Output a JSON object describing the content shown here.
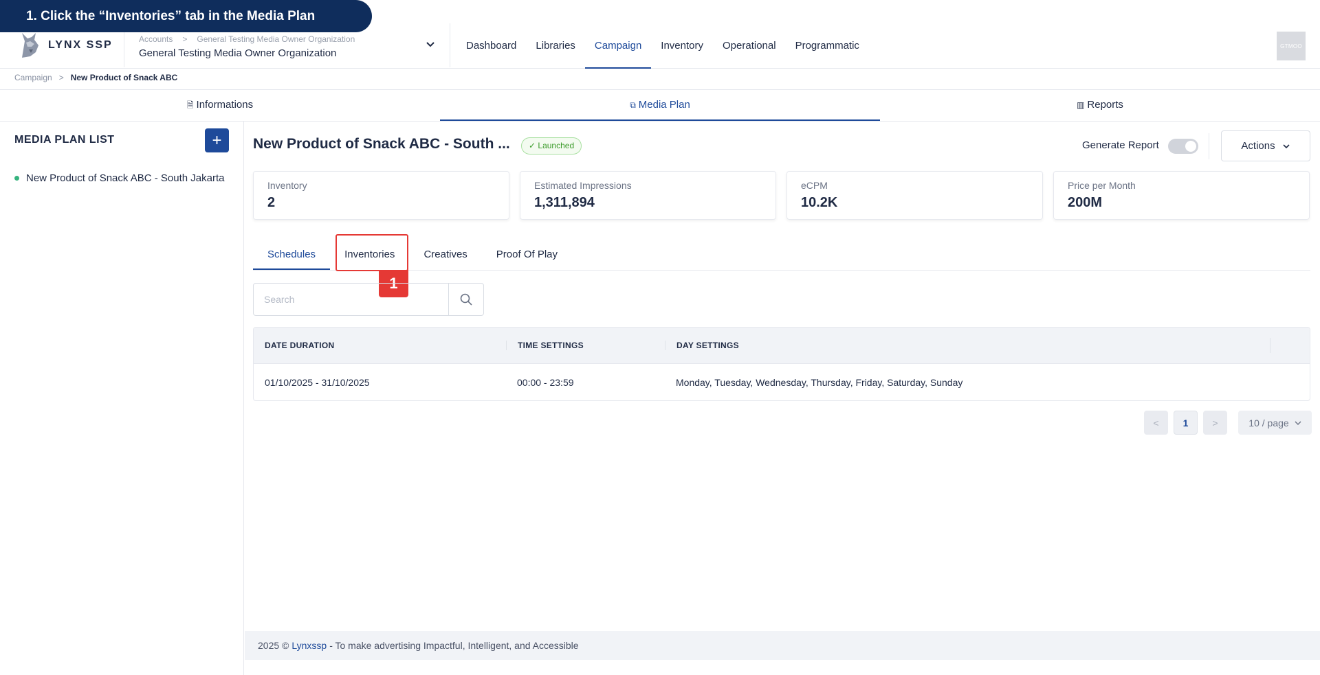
{
  "banner": {
    "text": "1. Click the “Inventories” tab in the Media Plan"
  },
  "logo": {
    "text": "LYNX SSP"
  },
  "org": {
    "crumbs": [
      "Accounts",
      "General Testing Media Owner Organization"
    ],
    "separator": ">",
    "name": "General Testing Media Owner Organization"
  },
  "nav": {
    "items": [
      {
        "label": "Dashboard"
      },
      {
        "label": "Libraries"
      },
      {
        "label": "Campaign"
      },
      {
        "label": "Inventory"
      },
      {
        "label": "Operational"
      },
      {
        "label": "Programmatic"
      }
    ],
    "active": "Campaign"
  },
  "avatar": {
    "text": "GTMOO"
  },
  "breadcrumb": {
    "items": [
      "Campaign",
      "New Product of Snack ABC"
    ],
    "separator": ">"
  },
  "main_tabs": [
    {
      "label": "Informations",
      "icon": "document-icon"
    },
    {
      "label": "Media Plan",
      "icon": "copy-icon"
    },
    {
      "label": "Reports",
      "icon": "bar-chart-icon"
    }
  ],
  "sidebar": {
    "title": "MEDIA PLAN LIST",
    "add_label": "+",
    "items": [
      {
        "label": "New Product of Snack ABC - South Jakarta"
      }
    ]
  },
  "plan": {
    "title": "New Product of Snack ABC - South ...",
    "status": "Launched",
    "generate_report_label": "Generate Report",
    "actions_label": "Actions"
  },
  "stats": [
    {
      "label": "Inventory",
      "value": "2"
    },
    {
      "label": "Estimated Impressions",
      "value": "1,311,894"
    },
    {
      "label": "eCPM",
      "value": "10.2K"
    },
    {
      "label": "Price per Month",
      "value": "200M"
    }
  ],
  "sub_tabs": [
    {
      "label": "Schedules"
    },
    {
      "label": "Inventories"
    },
    {
      "label": "Creatives"
    },
    {
      "label": "Proof Of Play"
    }
  ],
  "step_tag": "1",
  "search": {
    "placeholder": "Search",
    "value": ""
  },
  "table": {
    "columns": [
      "DATE DURATION",
      "TIME SETTINGS",
      "DAY SETTINGS"
    ],
    "rows": [
      [
        "01/10/2025 - 31/10/2025",
        "00:00 - 23:59",
        "Monday, Tuesday, Wednesday, Thursday, Friday, Saturday, Sunday"
      ]
    ]
  },
  "pagination": {
    "prev": "<",
    "current": "1",
    "next": ">",
    "page_size": "10 / page"
  },
  "footer": {
    "prefix": "2025 ©",
    "brand": "Lynxssp",
    "suffix": "- To make advertising Impactful, Intelligent, and Accessible"
  },
  "colors": {
    "primary": "#1e4a9a",
    "banner": "#0f2d5c",
    "highlight": "#e53935",
    "success": "#3b9b2a"
  }
}
